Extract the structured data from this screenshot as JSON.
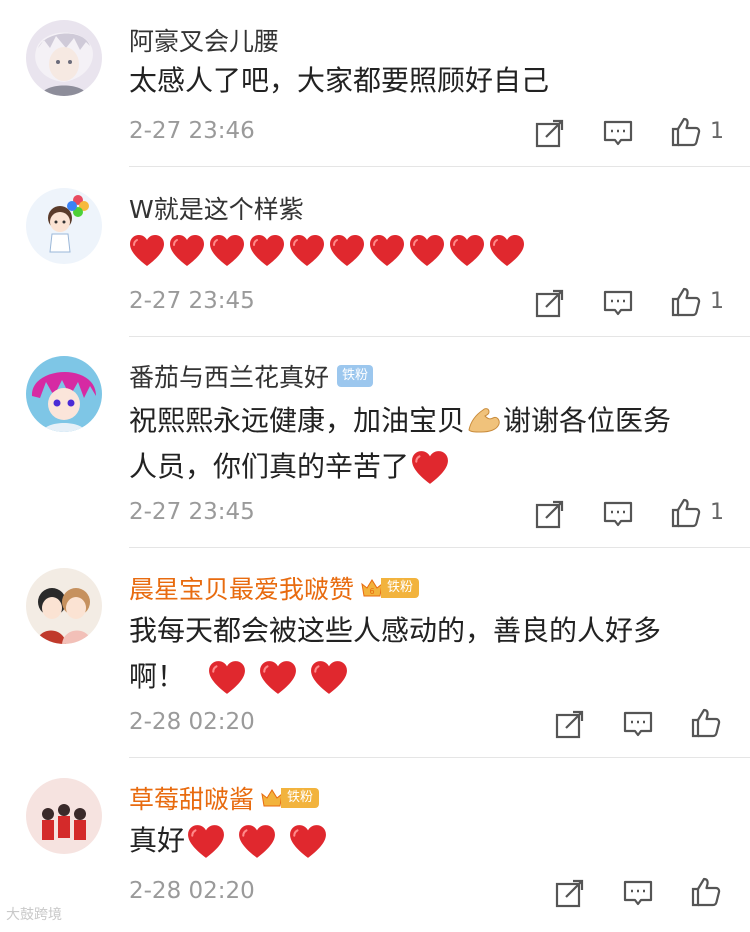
{
  "comments": [
    {
      "username": "阿豪叉会儿腰",
      "text": "太感人了吧，大家都要照顾好自己",
      "time": "2-27 23:46",
      "likes": "1"
    },
    {
      "username": "W就是这个样紫",
      "text": "",
      "time": "2-27 23:45",
      "likes": "1",
      "heart_count": 10
    },
    {
      "username": "番茄与西兰花真好",
      "badge": "铁粉",
      "text_line1": "祝熙熙永远健康，加油宝贝",
      "text_line1b": "谢谢各位医务",
      "text_line2": "人员，你们真的辛苦了",
      "time": "2-27 23:45",
      "likes": "1"
    },
    {
      "username": "晨星宝贝最爱我啵赞",
      "badge": "铁粉",
      "text_line1": "我每天都会被这些人感动的，善良的人好多",
      "text_line2": "啊！",
      "time": "2-28 02:20"
    },
    {
      "username": "草莓甜啵酱",
      "badge": "铁粉",
      "text": "真好",
      "time": "2-28 02:20"
    }
  ],
  "watermark": "大鼓跨境",
  "colors": {
    "vip_name": "#e86b0f",
    "heart": "#e0282e",
    "badge_blue": "#9cc7ee",
    "badge_gold": "#f2b33d"
  }
}
